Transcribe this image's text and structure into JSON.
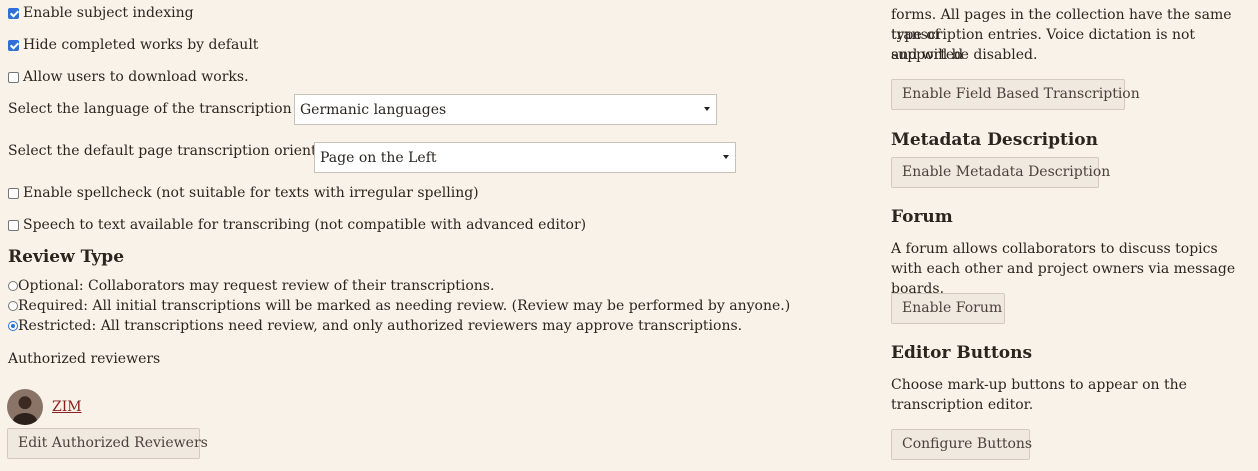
{
  "settings": {
    "subject_indexing": {
      "label": "Enable subject indexing",
      "checked": true
    },
    "hide_completed": {
      "label": "Hide completed works by default",
      "checked": true
    },
    "allow_download": {
      "label": "Allow users to download works.",
      "checked": false
    },
    "language": {
      "label": "Select the language of the transcription text",
      "value": "Germanic languages"
    },
    "orientation": {
      "label": "Select the default page transcription orientation",
      "value": "Page on the Left"
    },
    "spellcheck": {
      "label": "Enable spellcheck (not suitable for texts with irregular spelling)",
      "checked": false
    },
    "speech_to_text": {
      "label": "Speech to text available for transcribing (not compatible with advanced editor)",
      "checked": false
    }
  },
  "review": {
    "heading": "Review Type",
    "options": [
      {
        "label": "Optional: Collaborators may request review of their transcriptions.",
        "selected": false
      },
      {
        "label": "Required: All initial transcriptions will be marked as needing review. (Review may be performed by anyone.)",
        "selected": false
      },
      {
        "label": "Restricted: All transcriptions need review, and only authorized reviewers may approve transcriptions.",
        "selected": true
      }
    ],
    "authorized_label": "Authorized reviewers",
    "reviewer_name": "ZIM",
    "edit_button": "Edit Authorized Reviewers"
  },
  "right": {
    "field_based": {
      "text_line1": "forms. All pages in the collection have the same type of",
      "text_line2": "transcription entries. Voice dictation is not supported",
      "text_line3": "and will be disabled.",
      "button": "Enable Field Based Transcription"
    },
    "metadata": {
      "heading": "Metadata Description",
      "button": "Enable Metadata Description"
    },
    "forum": {
      "heading": "Forum",
      "text": "A forum allows collaborators to discuss topics with each other and project owners via message boards.",
      "button": "Enable Forum"
    },
    "editor_buttons": {
      "heading": "Editor Buttons",
      "text": "Choose mark-up buttons to appear on the transcription editor.",
      "button": "Configure Buttons"
    }
  },
  "colors": {
    "background": "#f9f2e8",
    "link": "#8a1d1d",
    "checkbox_accent": "#2f6fd6"
  }
}
